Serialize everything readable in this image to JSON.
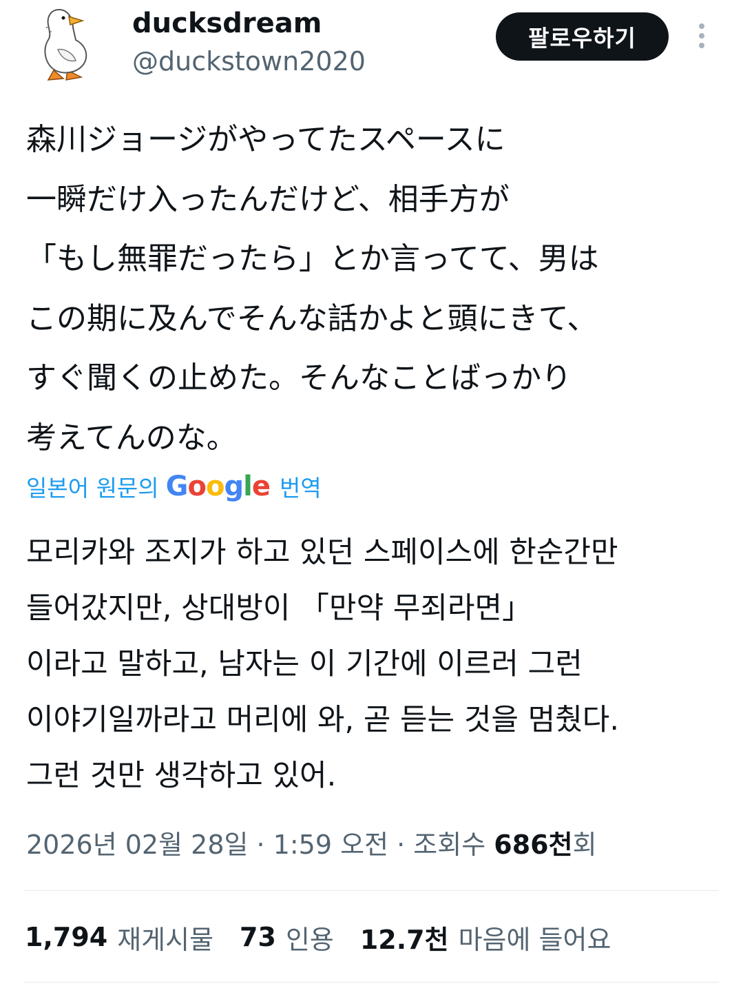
{
  "user": {
    "display_name": "ducksdream",
    "handle": "@duckstown2020",
    "avatar_icon": "duck-avatar"
  },
  "follow_label": "팔로우하기",
  "tweet": {
    "lines": [
      "森川ジョージがやってたスペースに",
      "一瞬だけ入ったんだけど、相手方が",
      "「もし無罪だったら」とか言ってて、男は",
      "この期に及んでそんな話かよと頭にきて、",
      "すぐ聞くの止めた。そんなことばっかり",
      "考えてんのな。"
    ]
  },
  "translation": {
    "prefix": "일본어 원문의",
    "google": [
      "G",
      "o",
      "o",
      "g",
      "l",
      "e"
    ],
    "google_colors": [
      "#4285f4",
      "#ea4335",
      "#fbbc05",
      "#4285f4",
      "#34a853",
      "#ea4335"
    ],
    "suffix": "번역",
    "lines": [
      "모리카와 조지가 하고 있던 스페이스에 한순간만",
      "들어갔지만, 상대방이 「만약 무죄라면」",
      "이라고 말하고, 남자는 이 기간에 이르러 그런",
      "이야기일까라고 머리에 와, 곧 듣는 것을 멈췄다.",
      "그런 것만 생각하고 있어."
    ]
  },
  "meta": {
    "date": "2026년 02월 28일",
    "sep1": " · ",
    "time": "1:59 오전",
    "sep2": " · ",
    "views_label": "조회수 ",
    "views_count": "686천",
    "views_suffix": "회"
  },
  "stats": [
    {
      "count": "1,794",
      "label": "재게시물"
    },
    {
      "count": "73",
      "label": "인용"
    },
    {
      "count": "12.7천",
      "label": "마음에 들어요"
    }
  ],
  "colors": {
    "text_primary": "#0f1419",
    "text_secondary": "#536471",
    "link": "#1d9bf0",
    "follow_bg": "#0f1419",
    "divider": "#e5e9ec"
  }
}
